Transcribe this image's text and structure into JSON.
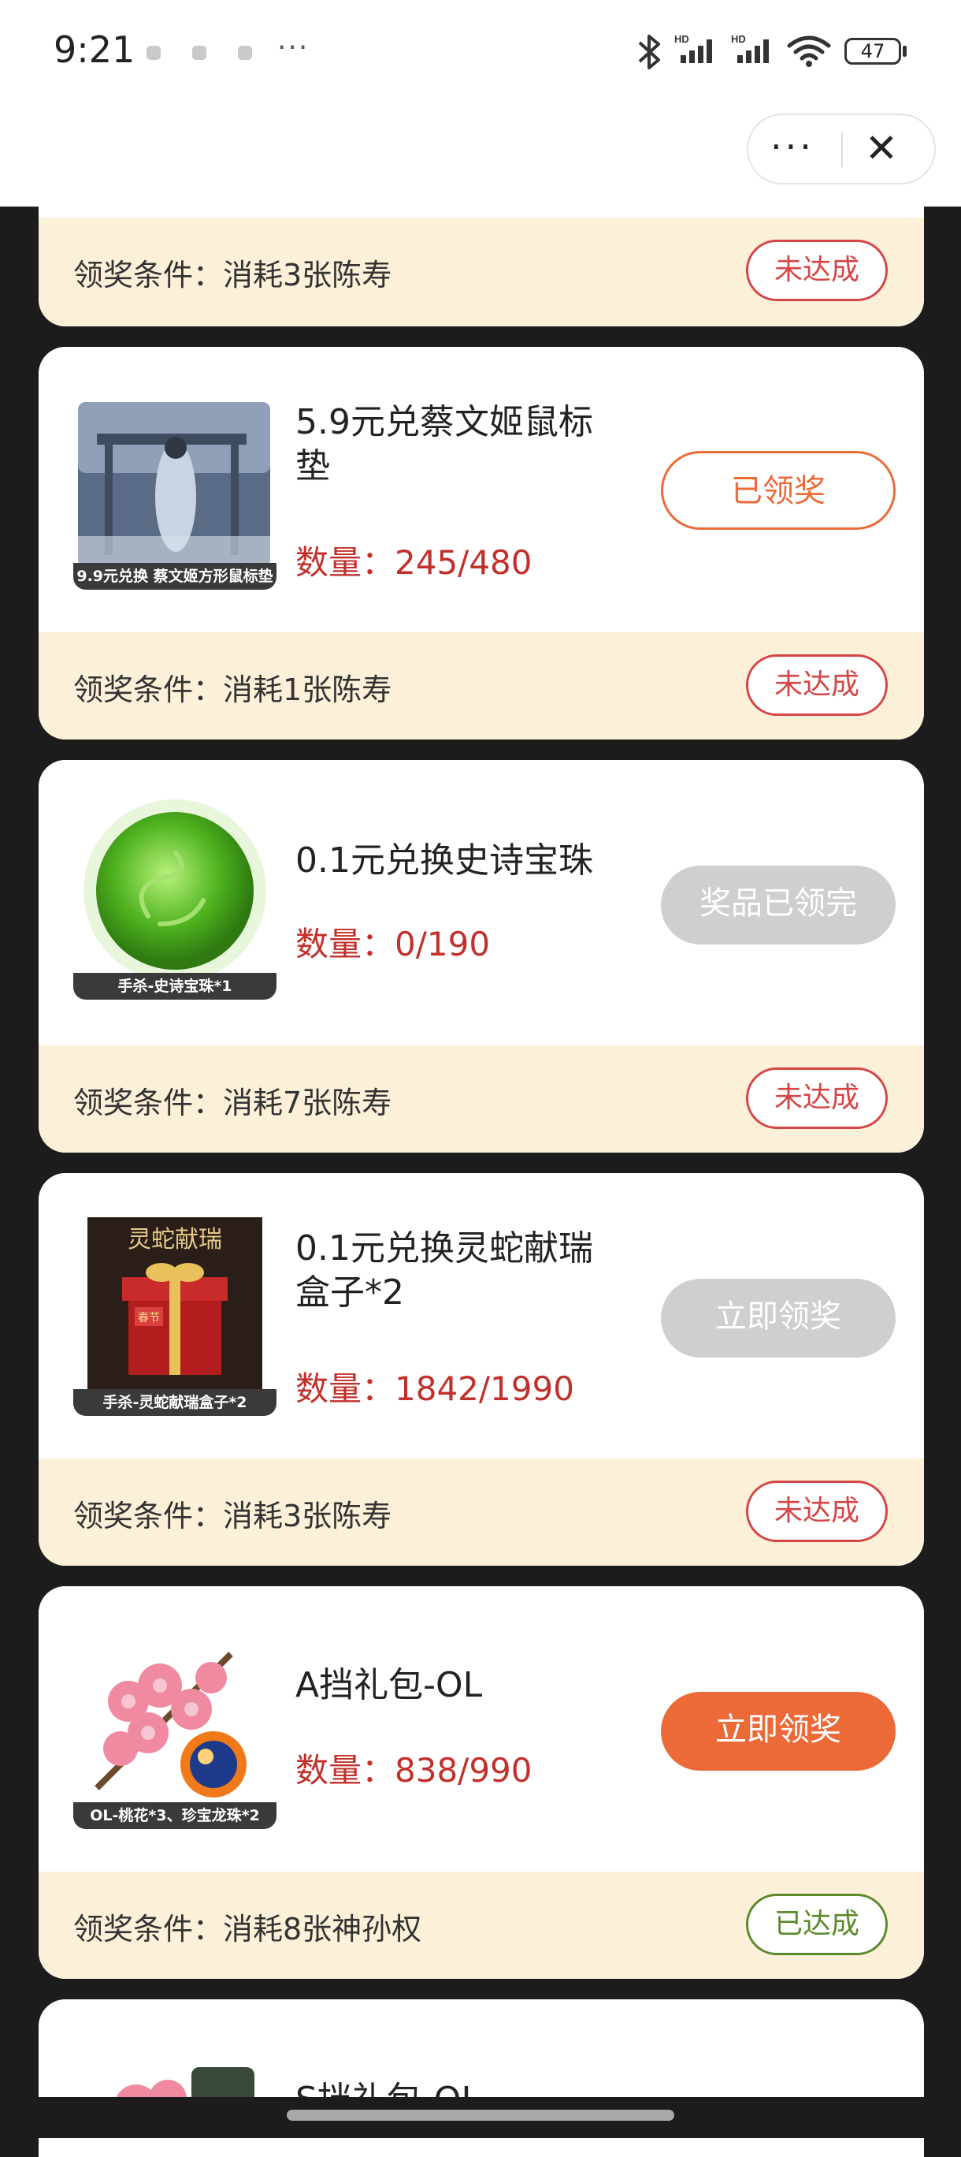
{
  "status_bar": {
    "time": "9:21",
    "more": "···",
    "hd1": "HD",
    "hd2": "HD",
    "battery": "47"
  },
  "nav": {
    "more_label": "···",
    "close_label": "✕"
  },
  "top_partial": {
    "condition": "领奖条件：消耗3张陈寿",
    "badge": "未达成"
  },
  "cards": [
    {
      "image_caption": "9.9元兑换 蔡文姬方形鼠标垫",
      "title_line1": "5.9元兑蔡文姬鼠标",
      "title_line2": "垫",
      "quantity": "数量：245/480",
      "action": "已领奖",
      "condition": "领奖条件：消耗1张陈寿",
      "badge": "未达成"
    },
    {
      "image_caption": "手杀-史诗宝珠*1",
      "title_line1": "0.1元兑换史诗宝珠",
      "title_line2": "",
      "quantity": "数量：0/190",
      "action": "奖品已领完",
      "condition": "领奖条件：消耗7张陈寿",
      "badge": "未达成"
    },
    {
      "image_caption": "手杀-灵蛇献瑞盒子*2",
      "image_text": "灵蛇献瑞",
      "image_tag": "春节",
      "title_line1": "0.1元兑换灵蛇献瑞",
      "title_line2": "盒子*2",
      "quantity": "数量：1842/1990",
      "action": "立即领奖",
      "condition": "领奖条件：消耗3张陈寿",
      "badge": "未达成"
    },
    {
      "image_caption": "OL-桃花*3、珍宝龙珠*2",
      "title_line1": "A挡礼包-OL",
      "title_line2": "",
      "quantity": "数量：838/990",
      "action": "立即领奖",
      "condition": "领奖条件：消耗8张神孙权",
      "badge": "已达成"
    },
    {
      "title_line1": "S挡礼包-OL"
    }
  ],
  "colors": {
    "accent_orange": "#ec6a37",
    "red_badge": "#d64545",
    "green_badge": "#5a8a2a",
    "disabled_gray": "#cfcfcf",
    "cream": "#fdf0d8"
  }
}
